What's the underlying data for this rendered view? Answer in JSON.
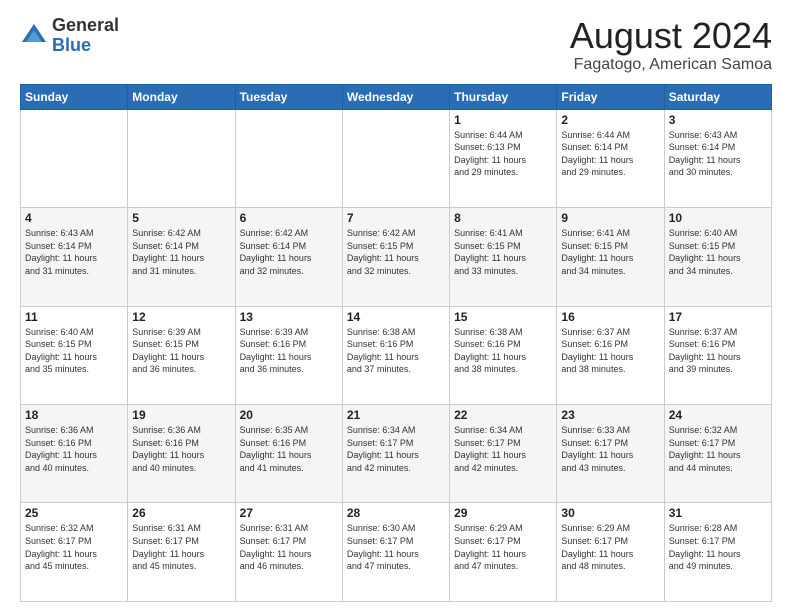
{
  "header": {
    "logo_general": "General",
    "logo_blue": "Blue",
    "month": "August 2024",
    "location": "Fagatogo, American Samoa"
  },
  "weekdays": [
    "Sunday",
    "Monday",
    "Tuesday",
    "Wednesday",
    "Thursday",
    "Friday",
    "Saturday"
  ],
  "weeks": [
    [
      {
        "day": "",
        "info": ""
      },
      {
        "day": "",
        "info": ""
      },
      {
        "day": "",
        "info": ""
      },
      {
        "day": "",
        "info": ""
      },
      {
        "day": "1",
        "info": "Sunrise: 6:44 AM\nSunset: 6:13 PM\nDaylight: 11 hours\nand 29 minutes."
      },
      {
        "day": "2",
        "info": "Sunrise: 6:44 AM\nSunset: 6:14 PM\nDaylight: 11 hours\nand 29 minutes."
      },
      {
        "day": "3",
        "info": "Sunrise: 6:43 AM\nSunset: 6:14 PM\nDaylight: 11 hours\nand 30 minutes."
      }
    ],
    [
      {
        "day": "4",
        "info": "Sunrise: 6:43 AM\nSunset: 6:14 PM\nDaylight: 11 hours\nand 31 minutes."
      },
      {
        "day": "5",
        "info": "Sunrise: 6:42 AM\nSunset: 6:14 PM\nDaylight: 11 hours\nand 31 minutes."
      },
      {
        "day": "6",
        "info": "Sunrise: 6:42 AM\nSunset: 6:14 PM\nDaylight: 11 hours\nand 32 minutes."
      },
      {
        "day": "7",
        "info": "Sunrise: 6:42 AM\nSunset: 6:15 PM\nDaylight: 11 hours\nand 32 minutes."
      },
      {
        "day": "8",
        "info": "Sunrise: 6:41 AM\nSunset: 6:15 PM\nDaylight: 11 hours\nand 33 minutes."
      },
      {
        "day": "9",
        "info": "Sunrise: 6:41 AM\nSunset: 6:15 PM\nDaylight: 11 hours\nand 34 minutes."
      },
      {
        "day": "10",
        "info": "Sunrise: 6:40 AM\nSunset: 6:15 PM\nDaylight: 11 hours\nand 34 minutes."
      }
    ],
    [
      {
        "day": "11",
        "info": "Sunrise: 6:40 AM\nSunset: 6:15 PM\nDaylight: 11 hours\nand 35 minutes."
      },
      {
        "day": "12",
        "info": "Sunrise: 6:39 AM\nSunset: 6:15 PM\nDaylight: 11 hours\nand 36 minutes."
      },
      {
        "day": "13",
        "info": "Sunrise: 6:39 AM\nSunset: 6:16 PM\nDaylight: 11 hours\nand 36 minutes."
      },
      {
        "day": "14",
        "info": "Sunrise: 6:38 AM\nSunset: 6:16 PM\nDaylight: 11 hours\nand 37 minutes."
      },
      {
        "day": "15",
        "info": "Sunrise: 6:38 AM\nSunset: 6:16 PM\nDaylight: 11 hours\nand 38 minutes."
      },
      {
        "day": "16",
        "info": "Sunrise: 6:37 AM\nSunset: 6:16 PM\nDaylight: 11 hours\nand 38 minutes."
      },
      {
        "day": "17",
        "info": "Sunrise: 6:37 AM\nSunset: 6:16 PM\nDaylight: 11 hours\nand 39 minutes."
      }
    ],
    [
      {
        "day": "18",
        "info": "Sunrise: 6:36 AM\nSunset: 6:16 PM\nDaylight: 11 hours\nand 40 minutes."
      },
      {
        "day": "19",
        "info": "Sunrise: 6:36 AM\nSunset: 6:16 PM\nDaylight: 11 hours\nand 40 minutes."
      },
      {
        "day": "20",
        "info": "Sunrise: 6:35 AM\nSunset: 6:16 PM\nDaylight: 11 hours\nand 41 minutes."
      },
      {
        "day": "21",
        "info": "Sunrise: 6:34 AM\nSunset: 6:17 PM\nDaylight: 11 hours\nand 42 minutes."
      },
      {
        "day": "22",
        "info": "Sunrise: 6:34 AM\nSunset: 6:17 PM\nDaylight: 11 hours\nand 42 minutes."
      },
      {
        "day": "23",
        "info": "Sunrise: 6:33 AM\nSunset: 6:17 PM\nDaylight: 11 hours\nand 43 minutes."
      },
      {
        "day": "24",
        "info": "Sunrise: 6:32 AM\nSunset: 6:17 PM\nDaylight: 11 hours\nand 44 minutes."
      }
    ],
    [
      {
        "day": "25",
        "info": "Sunrise: 6:32 AM\nSunset: 6:17 PM\nDaylight: 11 hours\nand 45 minutes."
      },
      {
        "day": "26",
        "info": "Sunrise: 6:31 AM\nSunset: 6:17 PM\nDaylight: 11 hours\nand 45 minutes."
      },
      {
        "day": "27",
        "info": "Sunrise: 6:31 AM\nSunset: 6:17 PM\nDaylight: 11 hours\nand 46 minutes."
      },
      {
        "day": "28",
        "info": "Sunrise: 6:30 AM\nSunset: 6:17 PM\nDaylight: 11 hours\nand 47 minutes."
      },
      {
        "day": "29",
        "info": "Sunrise: 6:29 AM\nSunset: 6:17 PM\nDaylight: 11 hours\nand 47 minutes."
      },
      {
        "day": "30",
        "info": "Sunrise: 6:29 AM\nSunset: 6:17 PM\nDaylight: 11 hours\nand 48 minutes."
      },
      {
        "day": "31",
        "info": "Sunrise: 6:28 AM\nSunset: 6:17 PM\nDaylight: 11 hours\nand 49 minutes."
      }
    ]
  ]
}
